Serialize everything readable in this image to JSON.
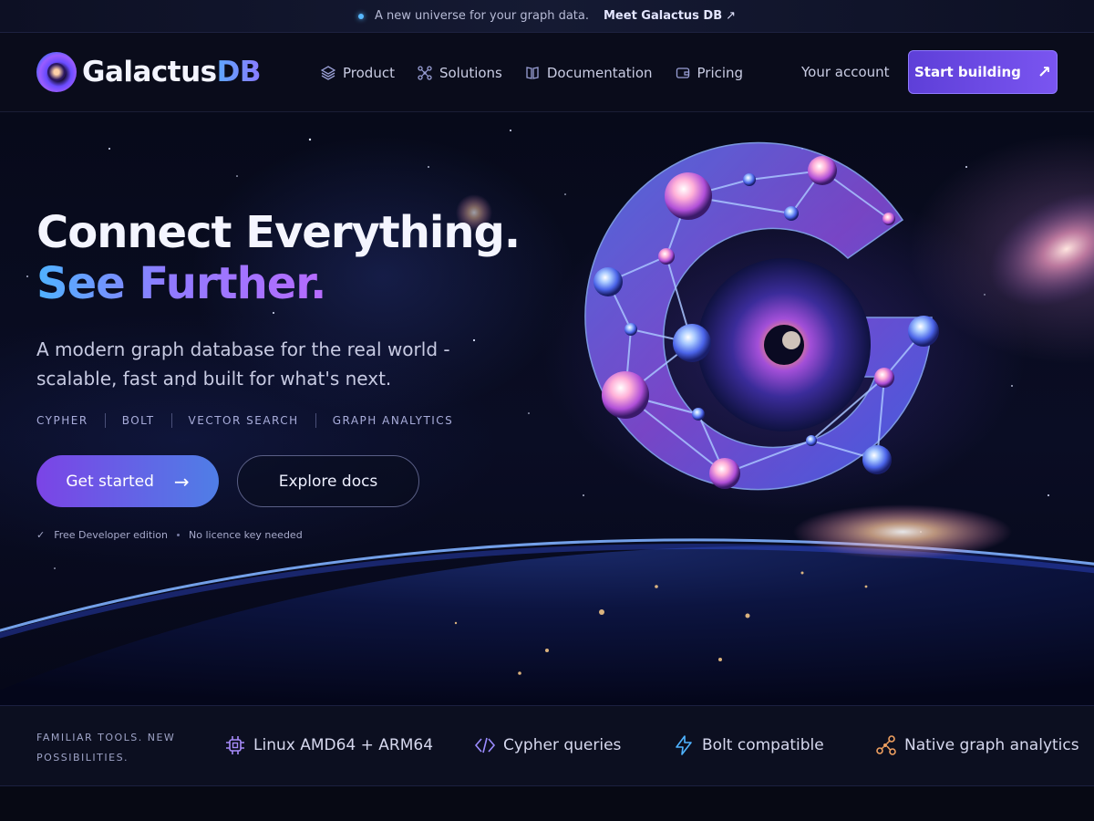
{
  "announcement": {
    "text": "A new universe for your graph data.",
    "link": "Meet Galactus DB",
    "link_icon": "arrow-up-right-icon"
  },
  "brand": {
    "name_part1": "Galactus",
    "name_part2": "DB",
    "icon": "galaxy-logo-icon"
  },
  "nav": {
    "items": [
      {
        "label": "Product",
        "icon": "layers-icon"
      },
      {
        "label": "Solutions",
        "icon": "network-icon"
      },
      {
        "label": "Documentation",
        "icon": "book-icon"
      },
      {
        "label": "Pricing",
        "icon": "wallet-icon"
      }
    ],
    "account": "Your account",
    "cta": "Start building",
    "cta_icon": "arrow-up-right-icon"
  },
  "hero": {
    "headline_line1": "Connect Everything.",
    "headline_line2": "See Further.",
    "lead": "A modern graph database for the real world - scalable, fast and built for what's next.",
    "tags": [
      "CYPHER",
      "BOLT",
      "VECTOR SEARCH",
      "GRAPH ANALYTICS"
    ],
    "primary_cta": "Get started",
    "secondary_cta": "Explore docs",
    "fine_print": [
      "Free Developer edition",
      "No licence key needed"
    ],
    "check_icon": "check-icon"
  },
  "features": {
    "title": "FAMILIAR TOOLS. NEW POSSIBILITIES.",
    "items": [
      {
        "label": "Linux AMD64 + ARM64",
        "icon": "cpu-chip-icon"
      },
      {
        "label": "Cypher queries",
        "icon": "code-brackets-icon"
      },
      {
        "label": "Bolt compatible",
        "icon": "lightning-bolt-icon"
      },
      {
        "label": "Native graph analytics",
        "icon": "graph-nodes-icon"
      }
    ]
  },
  "colors": {
    "background": "#070914",
    "accent_purple": "#7a55f0",
    "accent_blue": "#4fb3ff",
    "gradient_violet": "#b76bff"
  }
}
